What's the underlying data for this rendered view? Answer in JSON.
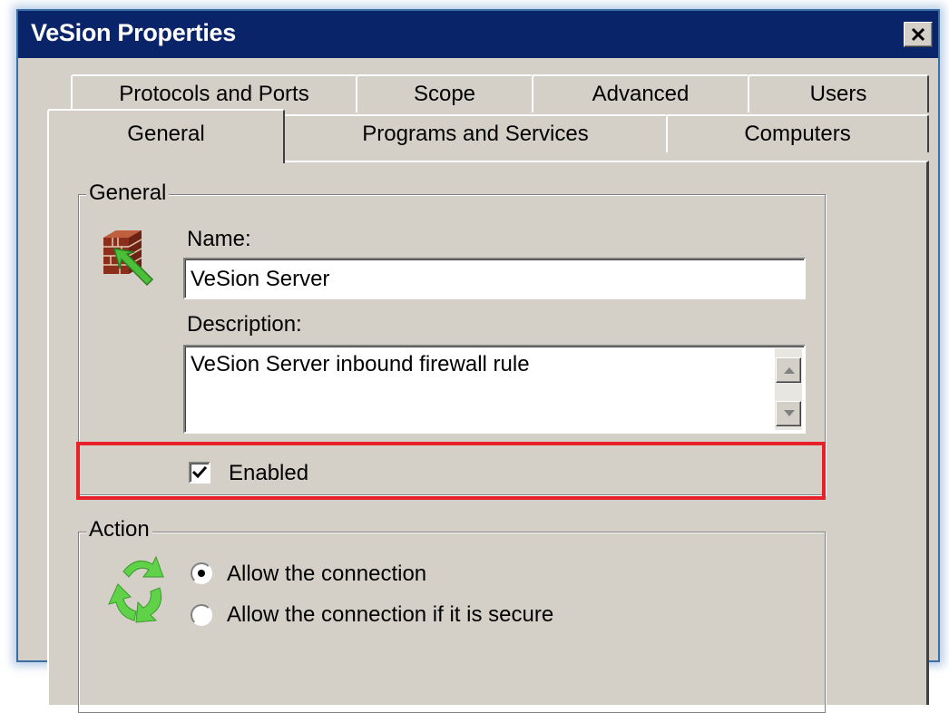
{
  "window": {
    "title": "VeSion Properties",
    "close_icon": "close-icon"
  },
  "tabs": {
    "back_row": [
      "Protocols and Ports",
      "Scope",
      "Advanced",
      "Users"
    ],
    "front_row": [
      "General",
      "Programs and Services",
      "Computers"
    ],
    "selected": "General"
  },
  "general": {
    "legend": "General",
    "icon": "firewall-rule-icon",
    "name_label": "Name:",
    "name_value": "VeSion Server",
    "description_label": "Description:",
    "description_value": "VeSion Server inbound firewall rule",
    "enabled_label": "Enabled",
    "enabled_checked": true
  },
  "action": {
    "legend": "Action",
    "icon": "action-arrows-icon",
    "options": [
      "Allow the connection",
      "Allow the connection if it is secure"
    ],
    "selected_index": 0
  },
  "highlight_color": "#e8202a"
}
